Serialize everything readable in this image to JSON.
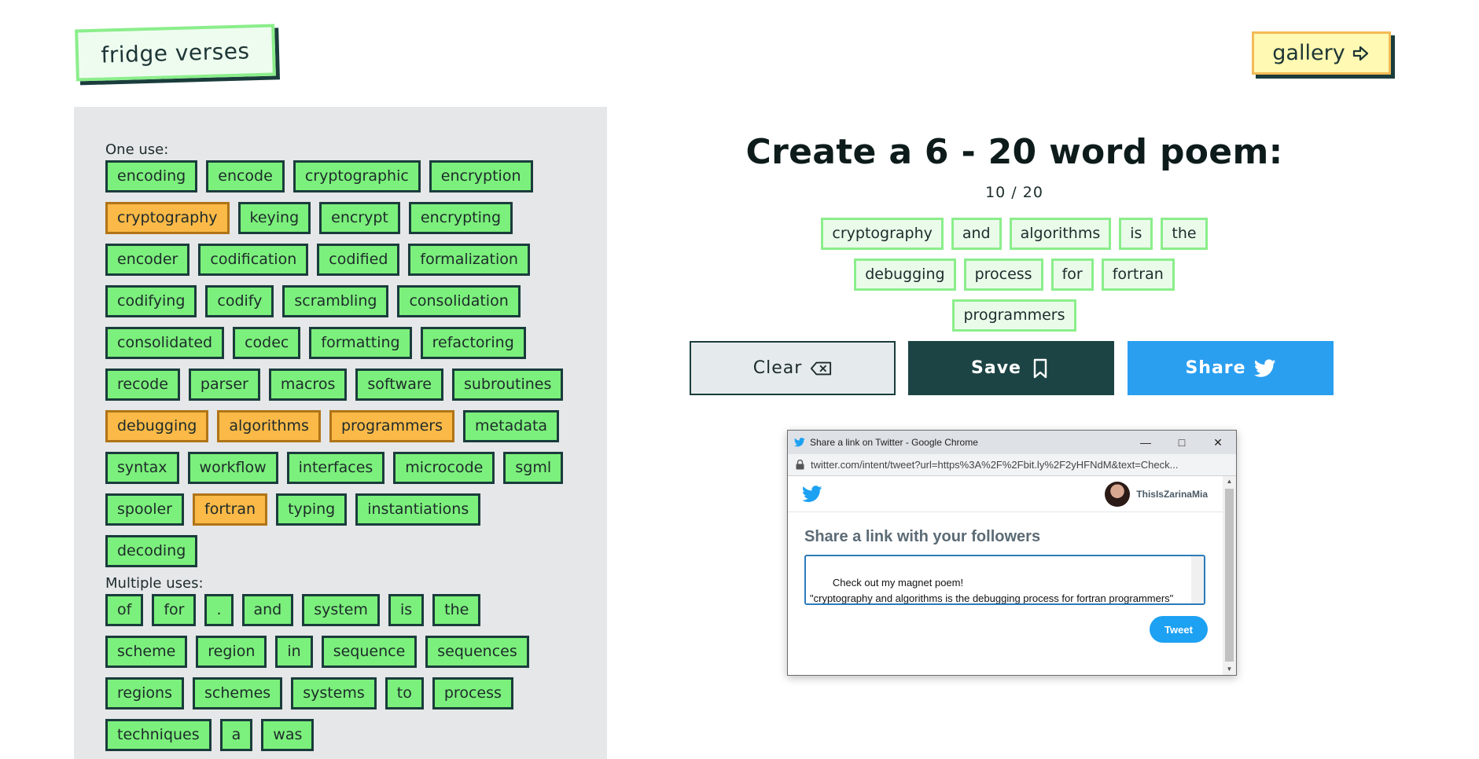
{
  "header": {
    "logo_text": "fridge verses",
    "gallery_label": "gallery",
    "gallery_icon": "arrow-right-icon"
  },
  "word_bank": {
    "one_use_label": "One use:",
    "one_use": [
      {
        "word": "encoding",
        "used": false
      },
      {
        "word": "encode",
        "used": false
      },
      {
        "word": "cryptographic",
        "used": false
      },
      {
        "word": "encryption",
        "used": false
      },
      {
        "word": "cryptography",
        "used": true
      },
      {
        "word": "keying",
        "used": false
      },
      {
        "word": "encrypt",
        "used": false
      },
      {
        "word": "encrypting",
        "used": false
      },
      {
        "word": "encoder",
        "used": false
      },
      {
        "word": "codification",
        "used": false
      },
      {
        "word": "codified",
        "used": false
      },
      {
        "word": "formalization",
        "used": false
      },
      {
        "word": "codifying",
        "used": false
      },
      {
        "word": "codify",
        "used": false
      },
      {
        "word": "scrambling",
        "used": false
      },
      {
        "word": "consolidation",
        "used": false
      },
      {
        "word": "consolidated",
        "used": false
      },
      {
        "word": "codec",
        "used": false
      },
      {
        "word": "formatting",
        "used": false
      },
      {
        "word": "refactoring",
        "used": false
      },
      {
        "word": "recode",
        "used": false
      },
      {
        "word": "parser",
        "used": false
      },
      {
        "word": "macros",
        "used": false
      },
      {
        "word": "software",
        "used": false
      },
      {
        "word": "subroutines",
        "used": false
      },
      {
        "word": "debugging",
        "used": true
      },
      {
        "word": "algorithms",
        "used": true
      },
      {
        "word": "programmers",
        "used": true
      },
      {
        "word": "metadata",
        "used": false
      },
      {
        "word": "syntax",
        "used": false
      },
      {
        "word": "workflow",
        "used": false
      },
      {
        "word": "interfaces",
        "used": false
      },
      {
        "word": "microcode",
        "used": false
      },
      {
        "word": "sgml",
        "used": false
      },
      {
        "word": "spooler",
        "used": false
      },
      {
        "word": "fortran",
        "used": true
      },
      {
        "word": "typing",
        "used": false
      },
      {
        "word": "instantiations",
        "used": false
      },
      {
        "word": "decoding",
        "used": false
      }
    ],
    "multiple_uses_label": "Multiple uses:",
    "multiple_uses": [
      "of",
      "for",
      ".",
      "and",
      "system",
      "is",
      "the",
      "scheme",
      "region",
      "in",
      "sequence",
      "sequences",
      "regions",
      "schemes",
      "systems",
      "to",
      "process",
      "techniques",
      "a",
      "was"
    ]
  },
  "composer": {
    "title": "Create a 6 - 20 word poem:",
    "count_text": "10 / 20",
    "poem_words": [
      "cryptography",
      "and",
      "algorithms",
      "is",
      "the",
      "debugging",
      "process",
      "for",
      "fortran",
      "programmers"
    ],
    "clear_label": "Clear",
    "clear_icon": "backspace-icon",
    "save_label": "Save",
    "save_icon": "bookmark-icon",
    "share_label": "Share",
    "share_icon": "twitter-bird-icon"
  },
  "popup": {
    "window_title": "Share a link on Twitter - Google Chrome",
    "url": "twitter.com/intent/tweet?url=https%3A%2F%2Fbit.ly%2F2yHFNdM&text=Check...",
    "username": "ThisIsZarinaMia",
    "heading": "Share a link with your followers",
    "tweet_text": "Check out my magnet poem!\n\"cryptography and algorithms is the debugging process for fortran programmers\"",
    "tweet_button": "Tweet"
  },
  "colors": {
    "tile_green": "#7cf07c",
    "tile_used_orange": "#fbb947",
    "dark_teal": "#1d4444",
    "twitter_blue": "#2a9ff0"
  }
}
